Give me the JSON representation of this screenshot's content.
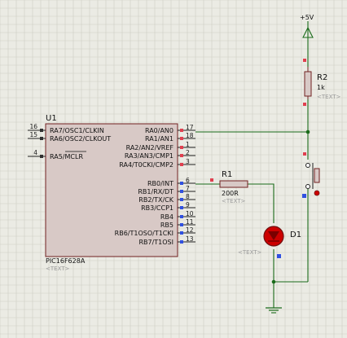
{
  "colors": {
    "background": "#ebebe4",
    "grid": "#cdcdc4",
    "wire": "#1a6b1a",
    "ic_fill": "#d8c9c6",
    "component_outline": "#702020",
    "pin_marker_red": "#e0404f",
    "pin_marker_blue": "#3050e0",
    "led_red": "#cc0000"
  },
  "power": {
    "label": "+5V"
  },
  "u1": {
    "ref": "U1",
    "part": "PIC16F628A",
    "text": "<TEXT>",
    "left_pins": [
      {
        "num": "16",
        "name": "RA7/OSC1/CLKIN"
      },
      {
        "num": "15",
        "name": "RA6/OSC2/CLKOUT"
      },
      {
        "num": "4",
        "name": "RA5/MCLR"
      }
    ],
    "right_pins": [
      {
        "num": "17",
        "name": "RA0/AN0"
      },
      {
        "num": "18",
        "name": "RA1/AN1"
      },
      {
        "num": "1",
        "name": "RA2/AN2/VREF"
      },
      {
        "num": "2",
        "name": "RA3/AN3/CMP1"
      },
      {
        "num": "3",
        "name": "RA4/T0CKI/CMP2"
      },
      {
        "num": "6",
        "name": "RB0/INT"
      },
      {
        "num": "7",
        "name": "RB1/RX/DT"
      },
      {
        "num": "8",
        "name": "RB2/TX/CK"
      },
      {
        "num": "9",
        "name": "RB3/CCP1"
      },
      {
        "num": "10",
        "name": "RB4"
      },
      {
        "num": "11",
        "name": "RB5"
      },
      {
        "num": "12",
        "name": "RB6/T1OSO/T1CKI"
      },
      {
        "num": "13",
        "name": "RB7/T1OSI"
      }
    ]
  },
  "r1": {
    "ref": "R1",
    "value": "200R",
    "text": "<TEXT>"
  },
  "r2": {
    "ref": "R2",
    "value": "1k",
    "text": "<TEXT>"
  },
  "d1": {
    "ref": "D1",
    "text": "<TEXT>"
  }
}
